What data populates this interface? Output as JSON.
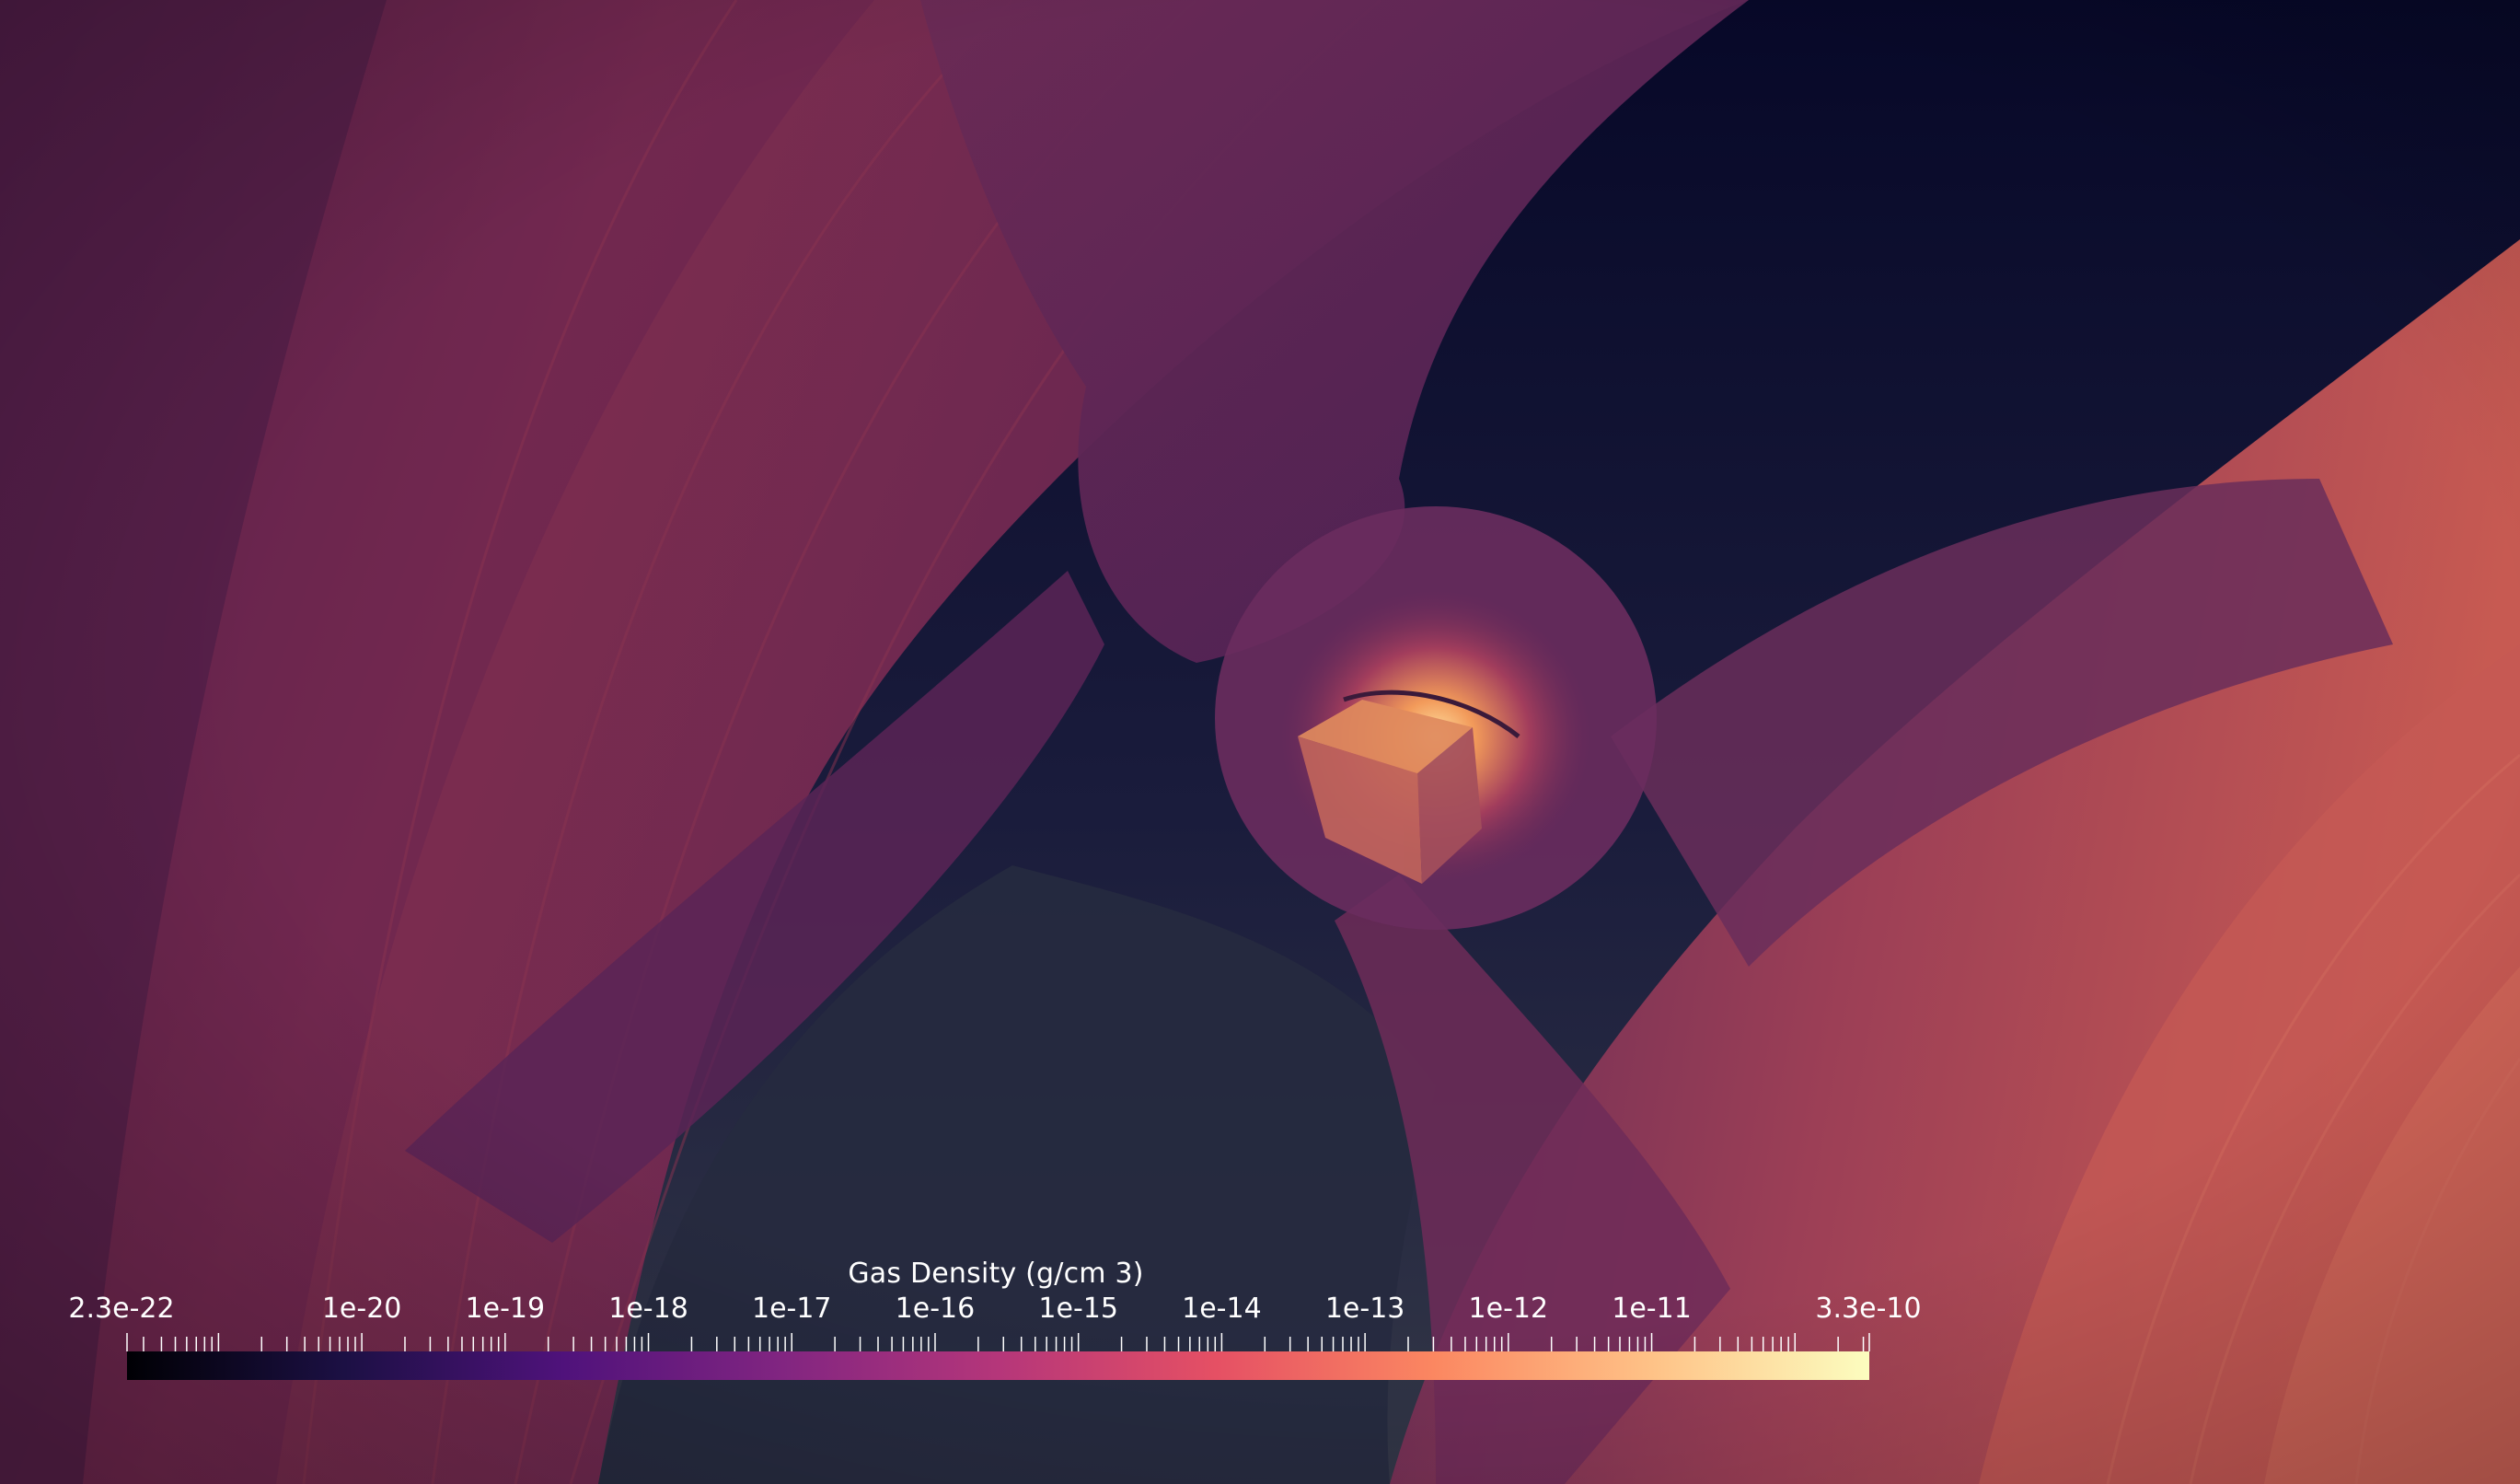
{
  "colorbar": {
    "title": "Gas Density (g/cm 3)",
    "scale": "log",
    "min_label": "2.3e-22",
    "max_label": "3.3e-10",
    "min_value": 2.3e-22,
    "max_value": 3.3e-10,
    "major_labels": [
      "1e-20",
      "1e-19",
      "1e-18",
      "1e-17",
      "1e-16",
      "1e-15",
      "1e-14",
      "1e-13",
      "1e-12",
      "1e-11"
    ],
    "major_exponents": [
      -20,
      -19,
      -18,
      -17,
      -16,
      -15,
      -14,
      -13,
      -12,
      -11
    ],
    "colormap": "magma",
    "colormap_stops": [
      "#000004",
      "#1c1044",
      "#4f127b",
      "#812581",
      "#b5367a",
      "#e55064",
      "#fb8761",
      "#fec287",
      "#fcfdbf"
    ]
  },
  "scene": {
    "background_top": "#080a2c",
    "background_bottom": "#303444",
    "shell_color": "#7a2c4c",
    "core_glow": "#f5a05a"
  }
}
